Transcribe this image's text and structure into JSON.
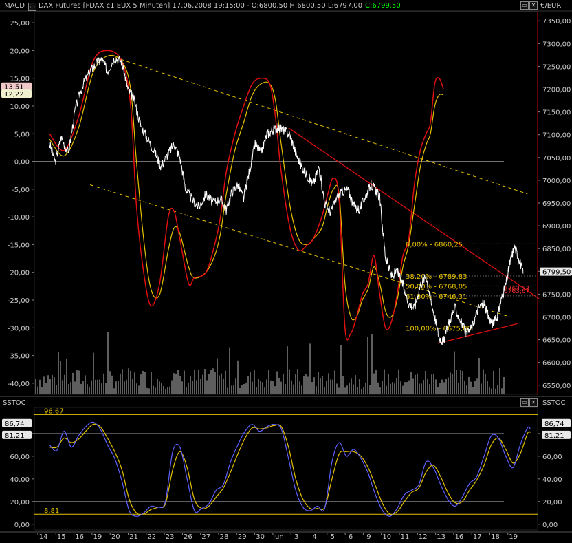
{
  "top_header": {
    "indicator_label": "MACD",
    "title": "DAX Futures [FDAX c1 EUX  5 Minuten] 17.06.2008 19:15:00 - O:6800.50 H:6800.50 L:6797.00",
    "close_text": "C:6799.50",
    "right_unit": "€/EUR"
  },
  "sstoc_header": {
    "left_label": "SSTOC",
    "right_label": "SSTOC"
  },
  "colors": {
    "background": "#000000",
    "price": "#ffffff",
    "macd_red": "#e01010",
    "macd_signal": "#e6c200",
    "channel": "#e6c200",
    "trendline": "#e01010",
    "fib": "#e6c200",
    "stoch_k": "#6060ff",
    "stoch_d": "#e6c200",
    "hline": "#7f7f7f",
    "axis_text": "#c8c8c8",
    "axis_border": "#c00000",
    "close_text": "#00ff00"
  },
  "icons": [
    "minimize-icon",
    "close-icon"
  ],
  "chart_data": [
    {
      "type": "line",
      "name": "price-macd-panel",
      "y_left_ticks": [
        "25,00",
        "20,00",
        "15,00",
        "10,00",
        "5,00",
        "0,00",
        "-5,00",
        "-10,00",
        "-15,00",
        "-20,00",
        "-25,00",
        "-30,00",
        "-35,00",
        "-40,00"
      ],
      "y_left_range": [
        -42,
        27
      ],
      "y_right_ticks": [
        "7350,00",
        "7300,00",
        "7250,00",
        "7200,00",
        "7150,00",
        "7100,00",
        "7050,00",
        "7000,00",
        "6950,00",
        "6900,00",
        "6850,00",
        "6800,00",
        "6750,00",
        "6700,00",
        "6650,00",
        "6600,00",
        "6550,00"
      ],
      "y_right_range": [
        6530,
        7370
      ],
      "left_markers": [
        {
          "label": "13,51",
          "value": 13.51
        },
        {
          "label": "12,22",
          "value": 12.22
        }
      ],
      "right_marker": {
        "label": "6799,50",
        "value": 6799.5
      },
      "trendline_labels": [
        "6763,57",
        "6763,67"
      ],
      "fib_levels": [
        {
          "label": "0,00% - 6860,25",
          "value": 6860.25
        },
        {
          "label": "38,20% - 6789,83",
          "value": 6789.83
        },
        {
          "label": "50,00% - 6768,05",
          "value": 6768.05
        },
        {
          "label": "61,80% - 6746,31",
          "value": 6746.31
        },
        {
          "label": "100,00% - 6675,88",
          "value": 6675.88
        }
      ],
      "price_anchors": [
        [
          14,
          7080
        ],
        [
          14.4,
          7040
        ],
        [
          14.8,
          7095
        ],
        [
          15.3,
          7060
        ],
        [
          15.8,
          7160
        ],
        [
          16.3,
          7210
        ],
        [
          16.8,
          7240
        ],
        [
          17.2,
          7255
        ],
        [
          17.6,
          7265
        ],
        [
          18,
          7240
        ],
        [
          18.5,
          7270
        ],
        [
          19,
          7260
        ],
        [
          19.4,
          7200
        ],
        [
          19.8,
          7180
        ],
        [
          20.3,
          7120
        ],
        [
          20.8,
          7090
        ],
        [
          21.3,
          7060
        ],
        [
          21.7,
          7030
        ],
        [
          22.2,
          7060
        ],
        [
          22.6,
          7080
        ],
        [
          23,
          7050
        ],
        [
          23.4,
          6980
        ],
        [
          23.8,
          6960
        ],
        [
          24.3,
          6940
        ],
        [
          24.8,
          6970
        ],
        [
          25.3,
          6950
        ],
        [
          25.8,
          6960
        ],
        [
          26.2,
          6935
        ],
        [
          26.6,
          6975
        ],
        [
          27,
          6990
        ],
        [
          27.4,
          6960
        ],
        [
          27.8,
          7020
        ],
        [
          28.2,
          7080
        ],
        [
          28.6,
          7060
        ],
        [
          29,
          7100
        ],
        [
          29.4,
          7110
        ],
        [
          29.8,
          7115
        ],
        [
          30.2,
          7110
        ],
        [
          30.6,
          7100
        ],
        [
          31,
          7060
        ],
        [
          31.4,
          7030
        ],
        [
          31.8,
          7010
        ],
        [
          32.2,
          6990
        ],
        [
          32.6,
          7030
        ],
        [
          33,
          6950
        ],
        [
          33.4,
          6930
        ],
        [
          33.8,
          6960
        ],
        [
          34.2,
          6975
        ],
        [
          34.6,
          6980
        ],
        [
          35,
          6945
        ],
        [
          35.4,
          6935
        ],
        [
          35.8,
          6965
        ],
        [
          36.2,
          6990
        ],
        [
          36.5,
          6980
        ],
        [
          36.8,
          6960
        ],
        [
          37.2,
          6830
        ],
        [
          37.6,
          6790
        ],
        [
          38,
          6800
        ],
        [
          38.4,
          6770
        ],
        [
          38.8,
          6730
        ],
        [
          39.2,
          6720
        ],
        [
          39.6,
          6770
        ],
        [
          40,
          6790
        ],
        [
          40.3,
          6740
        ],
        [
          40.6,
          6700
        ],
        [
          40.9,
          6655
        ],
        [
          41.2,
          6645
        ],
        [
          41.6,
          6690
        ],
        [
          42,
          6720
        ],
        [
          42.4,
          6690
        ],
        [
          42.8,
          6660
        ],
        [
          43.2,
          6680
        ],
        [
          43.6,
          6720
        ],
        [
          44,
          6730
        ],
        [
          44.3,
          6700
        ],
        [
          44.6,
          6685
        ],
        [
          44.9,
          6700
        ],
        [
          45.2,
          6740
        ],
        [
          45.5,
          6770
        ],
        [
          45.8,
          6820
        ],
        [
          46.1,
          6855
        ],
        [
          46.4,
          6830
        ],
        [
          46.7,
          6795
        ]
      ],
      "macd_red_anchors": [
        [
          14,
          5
        ],
        [
          15,
          2
        ],
        [
          16,
          8
        ],
        [
          17,
          18
        ],
        [
          18,
          20
        ],
        [
          19,
          18
        ],
        [
          19.6,
          10
        ],
        [
          20,
          -8
        ],
        [
          20.5,
          -20
        ],
        [
          21,
          -26
        ],
        [
          21.6,
          -22
        ],
        [
          22.2,
          -10
        ],
        [
          22.6,
          -9
        ],
        [
          23,
          -14
        ],
        [
          23.6,
          -22
        ],
        [
          24,
          -21
        ],
        [
          24.8,
          -20
        ],
        [
          25.4,
          -15
        ],
        [
          25.8,
          -10
        ],
        [
          26.2,
          -2
        ],
        [
          26.8,
          5
        ],
        [
          27.4,
          10
        ],
        [
          28,
          14
        ],
        [
          28.6,
          15
        ],
        [
          29.2,
          14
        ],
        [
          29.6,
          8
        ],
        [
          30,
          -2
        ],
        [
          30.6,
          -12
        ],
        [
          31.2,
          -16
        ],
        [
          31.8,
          -15
        ],
        [
          32.2,
          -14
        ],
        [
          32.8,
          -10
        ],
        [
          33.2,
          -6
        ],
        [
          33.6,
          -3
        ],
        [
          34,
          -7
        ],
        [
          34.4,
          -30
        ],
        [
          34.8,
          -31
        ],
        [
          35.2,
          -28
        ],
        [
          35.6,
          -24
        ],
        [
          36,
          -22
        ],
        [
          36.4,
          -17
        ],
        [
          36.8,
          -24
        ],
        [
          37.2,
          -30
        ],
        [
          37.6,
          -29
        ],
        [
          38,
          -24
        ],
        [
          38.4,
          -17
        ],
        [
          38.8,
          -14
        ],
        [
          39.2,
          -4
        ],
        [
          39.6,
          2
        ],
        [
          40,
          5
        ],
        [
          40.3,
          7
        ],
        [
          40.6,
          14
        ],
        [
          40.9,
          15
        ],
        [
          41.2,
          13
        ]
      ],
      "macd_signal_anchors": [
        [
          14,
          4
        ],
        [
          15,
          1
        ],
        [
          16,
          6
        ],
        [
          17,
          16
        ],
        [
          18,
          19
        ],
        [
          19,
          18
        ],
        [
          19.6,
          13
        ],
        [
          20,
          0
        ],
        [
          20.5,
          -14
        ],
        [
          21,
          -23
        ],
        [
          21.6,
          -24
        ],
        [
          22.2,
          -16
        ],
        [
          22.6,
          -12
        ],
        [
          23,
          -13
        ],
        [
          23.6,
          -19
        ],
        [
          24,
          -21
        ],
        [
          24.8,
          -20
        ],
        [
          25.4,
          -17
        ],
        [
          25.8,
          -13
        ],
        [
          26.2,
          -6
        ],
        [
          26.8,
          2
        ],
        [
          27.4,
          7
        ],
        [
          28,
          12
        ],
        [
          28.6,
          14
        ],
        [
          29.2,
          14
        ],
        [
          29.6,
          11
        ],
        [
          30,
          3
        ],
        [
          30.6,
          -8
        ],
        [
          31.2,
          -14
        ],
        [
          31.8,
          -15
        ],
        [
          32.2,
          -14
        ],
        [
          32.8,
          -12
        ],
        [
          33.2,
          -8
        ],
        [
          33.6,
          -5
        ],
        [
          34,
          -6
        ],
        [
          34.4,
          -22
        ],
        [
          34.8,
          -28
        ],
        [
          35.2,
          -28
        ],
        [
          35.6,
          -25
        ],
        [
          36,
          -23
        ],
        [
          36.4,
          -19
        ],
        [
          36.8,
          -22
        ],
        [
          37.2,
          -27
        ],
        [
          37.6,
          -28
        ],
        [
          38,
          -25
        ],
        [
          38.4,
          -19
        ],
        [
          38.8,
          -15
        ],
        [
          39.2,
          -8
        ],
        [
          39.6,
          -1
        ],
        [
          40,
          3
        ],
        [
          40.3,
          5
        ],
        [
          40.6,
          10
        ],
        [
          40.9,
          12
        ],
        [
          41.2,
          12
        ]
      ]
    },
    {
      "type": "line",
      "name": "sstoc-panel",
      "y_ticks": [
        "80,00",
        "60,00",
        "40,00",
        "20,00",
        "0,00"
      ],
      "y_range": [
        -5,
        103
      ],
      "levels": [
        {
          "label": "96.67",
          "value": 96.67
        },
        {
          "label": "8.81",
          "value": 8.81
        }
      ],
      "markers": [
        {
          "label": "86,74",
          "value": 86.74
        },
        {
          "label": "81,21",
          "value": 81.21
        }
      ],
      "k_anchors": [
        [
          14,
          70
        ],
        [
          14.5,
          65
        ],
        [
          15,
          82
        ],
        [
          15.5,
          68
        ],
        [
          16,
          78
        ],
        [
          16.5,
          86
        ],
        [
          17,
          90
        ],
        [
          17.5,
          84
        ],
        [
          18,
          70
        ],
        [
          18.5,
          58
        ],
        [
          19,
          38
        ],
        [
          19.5,
          12
        ],
        [
          20,
          7
        ],
        [
          20.5,
          10
        ],
        [
          21,
          16
        ],
        [
          21.5,
          15
        ],
        [
          22,
          20
        ],
        [
          22.5,
          64
        ],
        [
          23,
          68
        ],
        [
          23.5,
          40
        ],
        [
          24,
          12
        ],
        [
          24.5,
          14
        ],
        [
          25,
          18
        ],
        [
          25.5,
          30
        ],
        [
          26,
          35
        ],
        [
          26.5,
          55
        ],
        [
          27,
          70
        ],
        [
          27.5,
          82
        ],
        [
          28,
          88
        ],
        [
          28.5,
          82
        ],
        [
          29,
          86
        ],
        [
          29.5,
          88
        ],
        [
          30,
          84
        ],
        [
          30.5,
          58
        ],
        [
          31,
          30
        ],
        [
          31.5,
          15
        ],
        [
          32,
          12
        ],
        [
          32.5,
          16
        ],
        [
          33,
          14
        ],
        [
          33.5,
          55
        ],
        [
          34,
          72
        ],
        [
          34.5,
          60
        ],
        [
          35,
          66
        ],
        [
          35.5,
          58
        ],
        [
          36,
          45
        ],
        [
          36.5,
          26
        ],
        [
          37,
          12
        ],
        [
          37.5,
          7
        ],
        [
          38,
          14
        ],
        [
          38.5,
          26
        ],
        [
          39,
          30
        ],
        [
          39.5,
          35
        ],
        [
          40,
          55
        ],
        [
          40.5,
          50
        ],
        [
          41,
          35
        ],
        [
          41.5,
          22
        ],
        [
          42,
          16
        ],
        [
          42.5,
          24
        ],
        [
          43,
          36
        ],
        [
          43.5,
          42
        ],
        [
          44,
          60
        ],
        [
          44.5,
          78
        ],
        [
          45,
          76
        ],
        [
          45.5,
          60
        ],
        [
          46,
          50
        ],
        [
          46.5,
          70
        ],
        [
          47,
          85
        ],
        [
          47.2,
          84
        ]
      ],
      "d_anchors": [
        [
          14,
          68
        ],
        [
          14.5,
          68
        ],
        [
          15,
          76
        ],
        [
          15.5,
          72
        ],
        [
          16,
          75
        ],
        [
          16.5,
          82
        ],
        [
          17,
          88
        ],
        [
          17.5,
          86
        ],
        [
          18,
          76
        ],
        [
          18.5,
          64
        ],
        [
          19,
          48
        ],
        [
          19.5,
          22
        ],
        [
          20,
          10
        ],
        [
          20.5,
          9
        ],
        [
          21,
          13
        ],
        [
          21.5,
          15
        ],
        [
          22,
          18
        ],
        [
          22.5,
          48
        ],
        [
          23,
          64
        ],
        [
          23.5,
          50
        ],
        [
          24,
          22
        ],
        [
          24.5,
          14
        ],
        [
          25,
          16
        ],
        [
          25.5,
          24
        ],
        [
          26,
          32
        ],
        [
          26.5,
          46
        ],
        [
          27,
          62
        ],
        [
          27.5,
          76
        ],
        [
          28,
          85
        ],
        [
          28.5,
          84
        ],
        [
          29,
          85
        ],
        [
          29.5,
          87
        ],
        [
          30,
          86
        ],
        [
          30.5,
          68
        ],
        [
          31,
          40
        ],
        [
          31.5,
          22
        ],
        [
          32,
          14
        ],
        [
          32.5,
          14
        ],
        [
          33,
          15
        ],
        [
          33.5,
          40
        ],
        [
          34,
          62
        ],
        [
          34.5,
          64
        ],
        [
          35,
          64
        ],
        [
          35.5,
          60
        ],
        [
          36,
          50
        ],
        [
          36.5,
          34
        ],
        [
          37,
          18
        ],
        [
          37.5,
          9
        ],
        [
          38,
          11
        ],
        [
          38.5,
          20
        ],
        [
          39,
          28
        ],
        [
          39.5,
          32
        ],
        [
          40,
          46
        ],
        [
          40.5,
          52
        ],
        [
          41,
          42
        ],
        [
          41.5,
          28
        ],
        [
          42,
          19
        ],
        [
          42.5,
          20
        ],
        [
          43,
          30
        ],
        [
          43.5,
          39
        ],
        [
          44,
          52
        ],
        [
          44.5,
          70
        ],
        [
          45,
          76
        ],
        [
          45.5,
          66
        ],
        [
          46,
          54
        ],
        [
          46.5,
          62
        ],
        [
          47,
          80
        ],
        [
          47.2,
          81
        ]
      ]
    }
  ],
  "x_axis": {
    "labels": [
      "14",
      "15",
      "16",
      "19",
      "20",
      "21",
      "22",
      "23",
      "26",
      "27",
      "28",
      "29",
      "30",
      "Jun",
      "3",
      "4",
      "5",
      "6",
      "9",
      "10",
      "11",
      "12",
      "13",
      "16",
      "17",
      "18",
      "19"
    ]
  }
}
